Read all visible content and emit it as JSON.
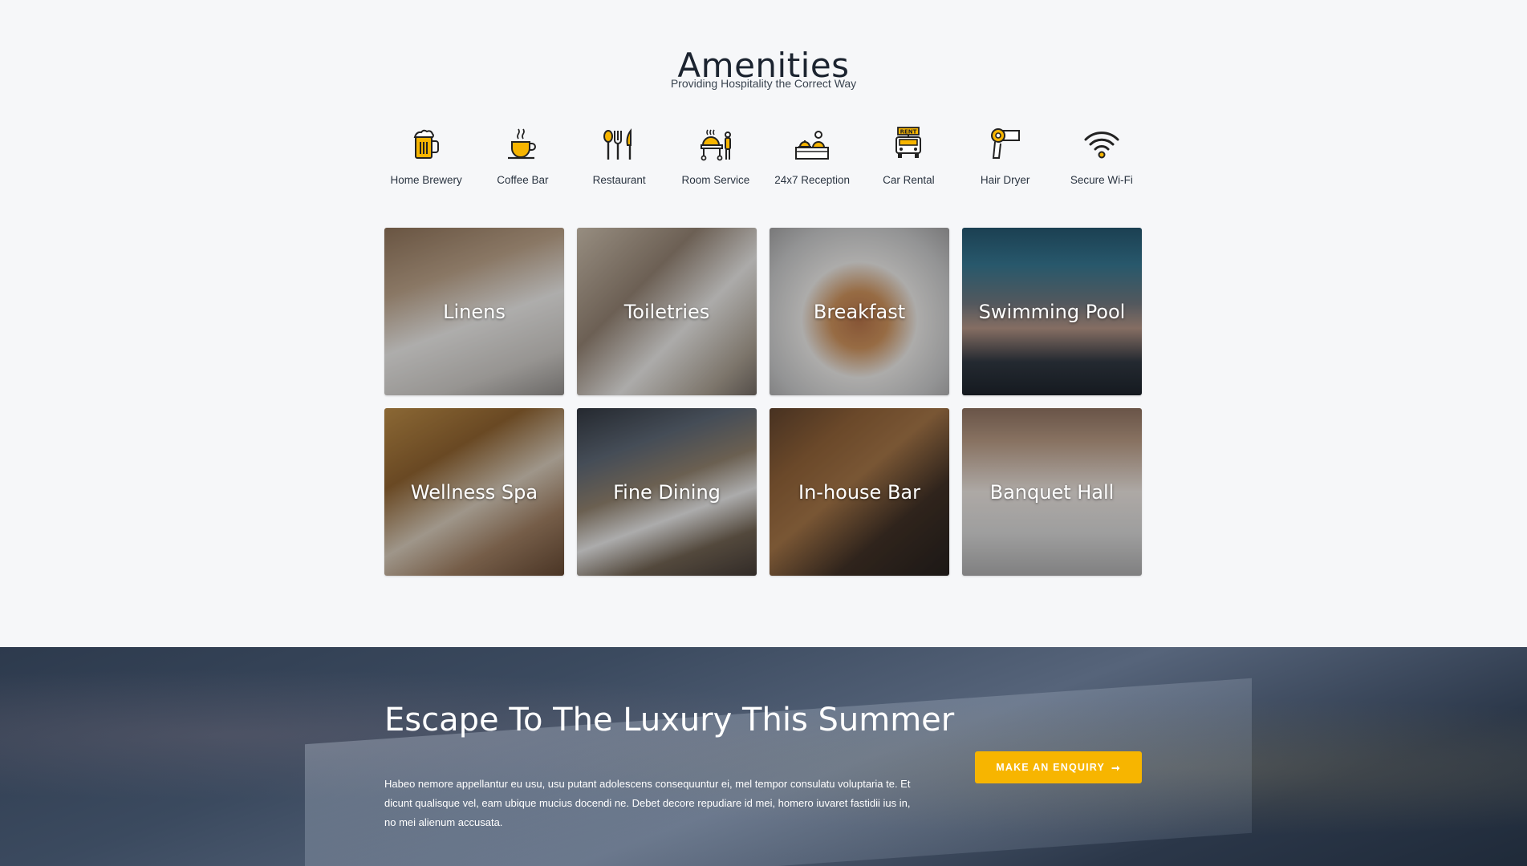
{
  "amenities": {
    "title": "Amenities",
    "subtitle": "Providing Hospitality the Correct Way",
    "icons": [
      {
        "label": "Home Brewery",
        "icon": "beer-mug-icon"
      },
      {
        "label": "Coffee Bar",
        "icon": "coffee-cup-icon"
      },
      {
        "label": "Restaurant",
        "icon": "utensils-icon"
      },
      {
        "label": "Room Service",
        "icon": "room-service-cart-icon"
      },
      {
        "label": "24x7 Reception",
        "icon": "reception-desk-icon"
      },
      {
        "label": "Car Rental",
        "icon": "rent-car-icon"
      },
      {
        "label": "Hair Dryer",
        "icon": "hair-dryer-icon"
      },
      {
        "label": "Secure Wi-Fi",
        "icon": "wifi-icon"
      }
    ],
    "icon_accent_color": "#f7b500",
    "cards": [
      {
        "label": "Linens"
      },
      {
        "label": "Toiletries"
      },
      {
        "label": "Breakfast"
      },
      {
        "label": "Swimming Pool"
      },
      {
        "label": "Wellness Spa"
      },
      {
        "label": "Fine Dining"
      },
      {
        "label": "In-house Bar"
      },
      {
        "label": "Banquet Hall"
      }
    ]
  },
  "cta": {
    "title": "Escape To The Luxury This Summer",
    "text": "Habeo nemore appellantur eu usu, usu putant adolescens consequuntur ei, mel tempor consulatu voluptaria te. Et dicunt qualisque vel, eam ubique mucius docendi ne. Debet decore repudiare id mei, homero iuvaret fastidii ius in, no mei alienum accusata.",
    "button_label": "MAKE AN ENQUIRY",
    "button_arrow": "➞",
    "button_color": "#f7b500"
  }
}
